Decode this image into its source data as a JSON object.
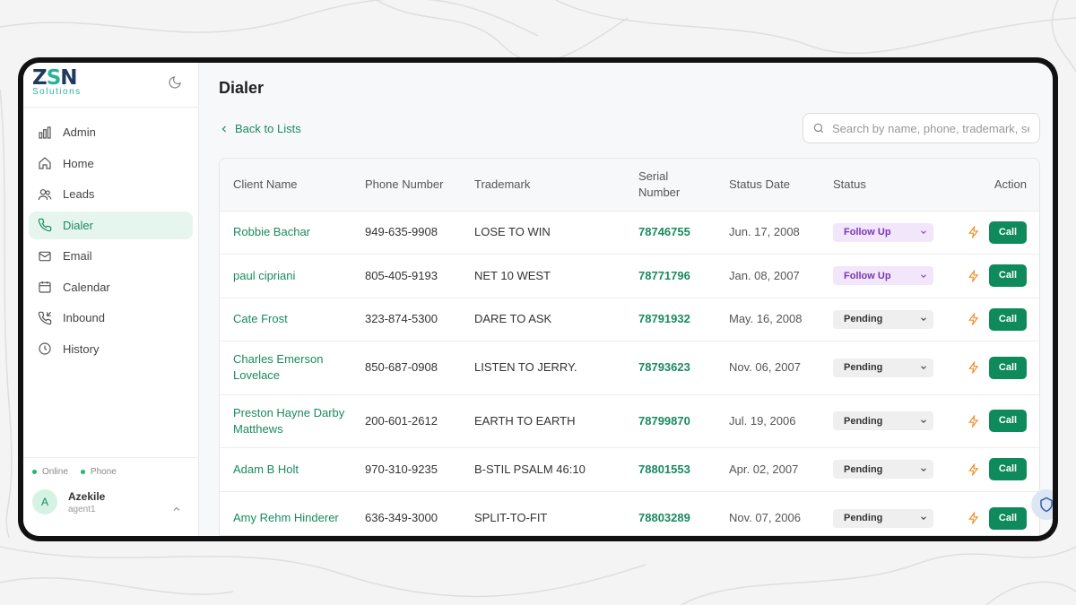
{
  "brand": {
    "logo_main_a": "Z",
    "logo_main_s": "S",
    "logo_main_b": "N",
    "logo_sub": "Solutions"
  },
  "nav": [
    {
      "label": "Admin",
      "icon": "bar-chart-icon"
    },
    {
      "label": "Home",
      "icon": "home-icon"
    },
    {
      "label": "Leads",
      "icon": "users-icon"
    },
    {
      "label": "Dialer",
      "icon": "phone-icon",
      "active": true
    },
    {
      "label": "Email",
      "icon": "mail-icon"
    },
    {
      "label": "Calendar",
      "icon": "calendar-icon"
    },
    {
      "label": "Inbound",
      "icon": "phone-incoming-icon"
    },
    {
      "label": "History",
      "icon": "clock-icon"
    }
  ],
  "presence": {
    "online": "Online",
    "phone": "Phone"
  },
  "user": {
    "initial": "A",
    "name": "Azekile",
    "role": "agent1"
  },
  "page": {
    "title": "Dialer",
    "back_label": "Back to Lists"
  },
  "search": {
    "placeholder": "Search by name, phone, trademark, serial...",
    "value": ""
  },
  "table": {
    "headers": {
      "client": "Client Name",
      "phone": "Phone Number",
      "trademark": "Trademark",
      "serial_line1": "Serial",
      "serial_line2": "Number",
      "date": "Status Date",
      "status": "Status",
      "action": "Action"
    },
    "call_label": "Call",
    "rows": [
      {
        "client": "Robbie Bachar",
        "phone": "949-635-9908",
        "trademark": "LOSE TO WIN",
        "serial": "78746755",
        "date": "Jun. 17, 2008",
        "status": "Follow Up"
      },
      {
        "client": "paul cipriani",
        "phone": "805-405-9193",
        "trademark": "NET 10 WEST",
        "serial": "78771796",
        "date": "Jan. 08, 2007",
        "status": "Follow Up"
      },
      {
        "client": "Cate Frost",
        "phone": "323-874-5300",
        "trademark": "DARE TO ASK",
        "serial": "78791932",
        "date": "May. 16, 2008",
        "status": "Pending"
      },
      {
        "client": "Charles Emerson Lovelace",
        "phone": "850-687-0908",
        "trademark": "LISTEN TO JERRY.",
        "serial": "78793623",
        "date": "Nov. 06, 2007",
        "status": "Pending"
      },
      {
        "client": "Preston Hayne Darby Matthews",
        "phone": "200-601-2612",
        "trademark": "EARTH TO EARTH",
        "serial": "78799870",
        "date": "Jul. 19, 2006",
        "status": "Pending"
      },
      {
        "client": "Adam B Holt",
        "phone": "970-310-9235",
        "trademark": "B-STIL PSALM 46:10",
        "serial": "78801553",
        "date": "Apr. 02, 2007",
        "status": "Pending"
      },
      {
        "client": "Amy Rehm Hinderer",
        "phone": "636-349-3000",
        "trademark": "SPLIT-TO-FIT",
        "serial": "78803289",
        "date": "Nov. 07, 2006",
        "status": "Pending"
      }
    ]
  },
  "colors": {
    "accent": "#1a8a5f",
    "call_button": "#0f8a5a",
    "follow_up_bg": "#f2e6fb",
    "follow_up_text": "#7a35b5",
    "bolt": "#f08a24"
  }
}
